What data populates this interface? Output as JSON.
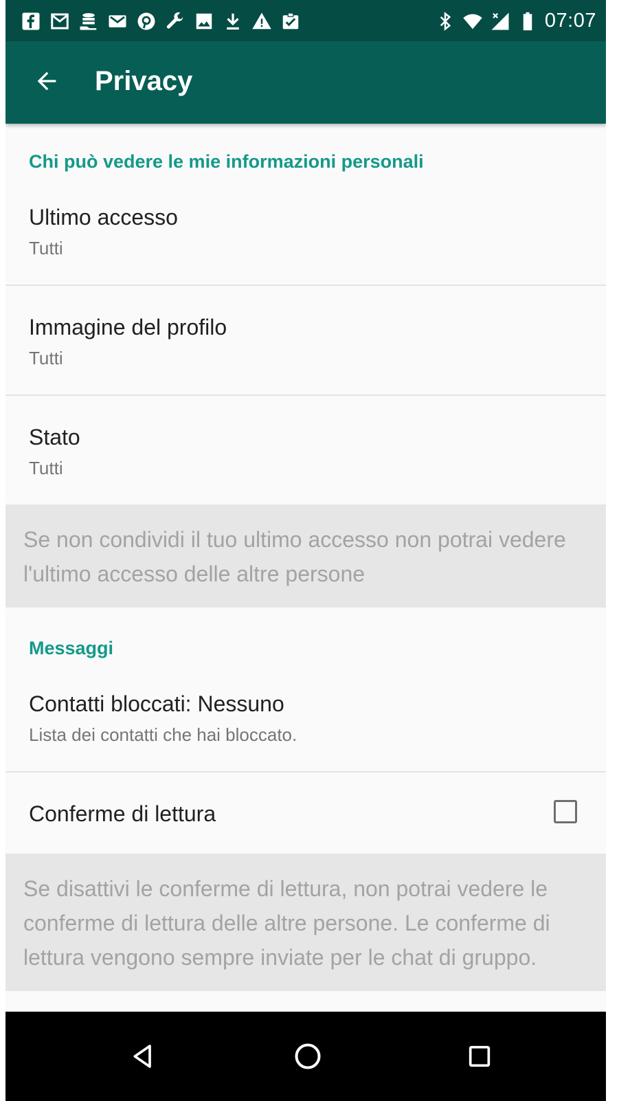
{
  "status_bar": {
    "time": "07:07",
    "left_icons": [
      "facebook-icon",
      "email-icon",
      "coins-icon",
      "mail-icon",
      "pinterest-icon",
      "wrench-icon",
      "image-icon",
      "download-icon",
      "warning-icon",
      "clipboard-check-icon"
    ],
    "right_icons": [
      "bluetooth-icon",
      "wifi-icon",
      "cell-signal-icon",
      "battery-icon"
    ]
  },
  "toolbar": {
    "title": "Privacy",
    "back_icon": "arrow-left-icon"
  },
  "sections": {
    "personal": {
      "header": "Chi può vedere le mie informazioni personali",
      "items": [
        {
          "title": "Ultimo accesso",
          "subtitle": "Tutti"
        },
        {
          "title": "Immagine del profilo",
          "subtitle": "Tutti"
        },
        {
          "title": "Stato",
          "subtitle": "Tutti"
        }
      ],
      "note": "Se non condividi il tuo ultimo accesso non potrai vedere l'ultimo accesso delle altre persone"
    },
    "messages": {
      "header": "Messaggi",
      "blocked": {
        "title": "Contatti bloccati: Nessuno",
        "subtitle": "Lista dei contatti che hai bloccato."
      },
      "read_receipts": {
        "title": "Conferme di lettura",
        "checked": false
      },
      "note": "Se disattivi le conferme di lettura, non potrai vedere le conferme di lettura delle altre persone. Le conferme di lettura vengono sempre inviate per le chat di gruppo."
    }
  },
  "nav_bar": {
    "buttons": [
      "back-triangle-icon",
      "home-circle-icon",
      "recents-square-icon"
    ]
  },
  "colors": {
    "status_bar": "#054c44",
    "toolbar": "#075e54",
    "accent": "#14998a",
    "note_bg": "#e6e6e6"
  }
}
